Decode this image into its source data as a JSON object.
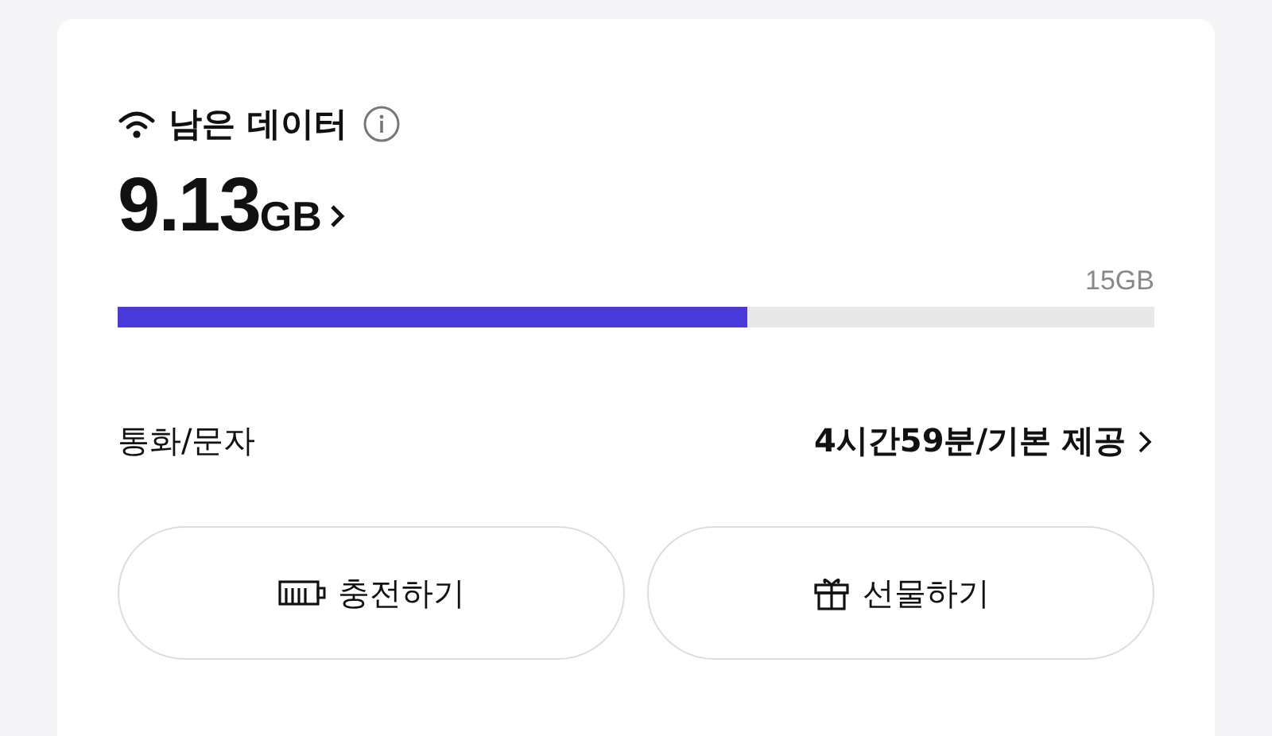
{
  "data_card": {
    "title": "남은 데이터",
    "remaining_value": "9.13",
    "remaining_unit": "GB",
    "total_label": "15GB",
    "usage_bar": {
      "level": 0.607
    },
    "call_text": {
      "label": "통화/문자",
      "value": "4시간59분/기본 제공"
    }
  },
  "buttons": [
    {
      "kind": "charge",
      "label": "충전하기"
    },
    {
      "kind": "gift",
      "label": "선물하기"
    }
  ]
}
